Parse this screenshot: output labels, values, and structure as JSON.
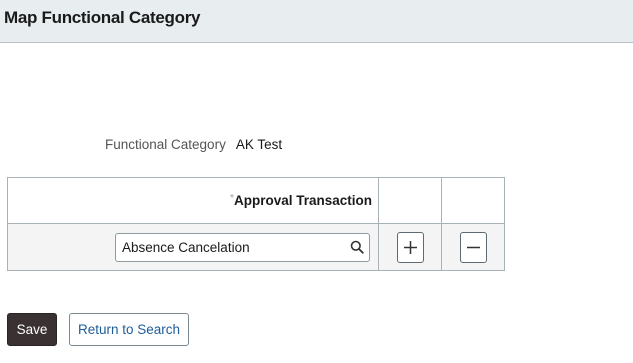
{
  "page": {
    "title": "Map Functional Category"
  },
  "functional_category": {
    "label": "Functional Category",
    "value": "AK Test"
  },
  "grid": {
    "required_marker": "*",
    "column_header": "Approval Transaction",
    "rows": [
      {
        "approval_transaction": "Absence Cancelation"
      }
    ]
  },
  "icons": {
    "lookup": "magnifier-icon",
    "add_row": "plus-icon",
    "delete_row": "minus-icon"
  },
  "buttons": {
    "save_label": "Save",
    "return_label": "Return to Search"
  },
  "colors": {
    "header_background": "#e8eef0",
    "save_button": "#3a3232",
    "link_blue": "#1f5c99"
  }
}
